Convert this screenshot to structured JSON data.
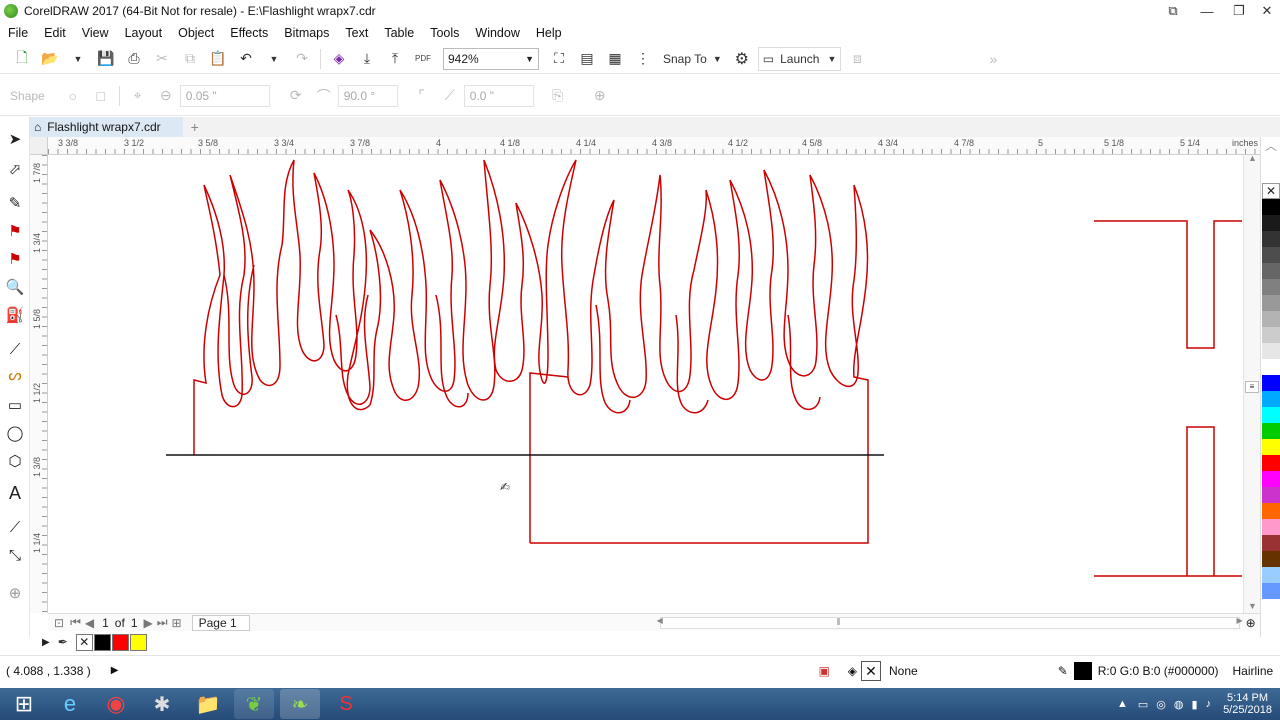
{
  "window": {
    "title": "CorelDRAW 2017 (64-Bit Not for resale) - E:\\Flashlight wrapx7.cdr",
    "controls": {
      "minimize": "—",
      "maximize": "❐",
      "close": "✕"
    }
  },
  "menu": [
    "File",
    "Edit",
    "View",
    "Layout",
    "Object",
    "Effects",
    "Bitmaps",
    "Text",
    "Table",
    "Tools",
    "Window",
    "Help"
  ],
  "toolbar": {
    "zoom_value": "942%",
    "snap_to_label": "Snap To",
    "launch_label": "Launch",
    "pdf_label": "PDF"
  },
  "property_bar": {
    "shape_label": "Shape",
    "outline_width": "0.05 \"",
    "rotation_angle": "90.0 °",
    "corner_value": "0.0 \""
  },
  "document_tab": {
    "name": "Flashlight wrapx7.cdr"
  },
  "ruler": {
    "units": "inches",
    "h_ticks": [
      "3 3/8",
      "3 1/2",
      "3 5/8",
      "3 3/4",
      "3 7/8",
      "4",
      "4 1/8",
      "4 1/4",
      "4 3/8",
      "4 1/2",
      "4 5/8",
      "4 3/4",
      "4 7/8",
      "5",
      "5 1/8",
      "5 1/4"
    ],
    "v_ticks": [
      "1 7/8",
      "1 3/4",
      "1 5/8",
      "1 1/2",
      "1 3/8",
      "1 1/4"
    ]
  },
  "page_nav": {
    "current": "1",
    "of_label": "of",
    "total": "1",
    "page_tab": "Page 1"
  },
  "status": {
    "cursor_coords": "( 4.088 , 1.338 )",
    "fill_label": "None",
    "outline_color": "R:0 G:0 B:0 (#000000)",
    "outline_weight": "Hairline"
  },
  "palette_colors": [
    "#000000",
    "#1a1a1a",
    "#333333",
    "#4d4d4d",
    "#666666",
    "#808080",
    "#999999",
    "#b3b3b3",
    "#cccccc",
    "#e6e6e6",
    "#ffffff",
    "#0000ff",
    "#00aaff",
    "#00ffff",
    "#00cc00",
    "#ffff00",
    "#ff0000",
    "#ff00ff",
    "#cc33cc",
    "#ff6600",
    "#ff99cc",
    "#993333",
    "#663300",
    "#99ccff",
    "#6699ff"
  ],
  "document_colors": [
    "#000000",
    "#ff0000",
    "#ffff00"
  ],
  "taskbar": {
    "time": "5:14 PM",
    "date": "5/25/2018"
  },
  "colors": {
    "accent": "#cc0000",
    "selection_tab": "#dde8f5"
  }
}
